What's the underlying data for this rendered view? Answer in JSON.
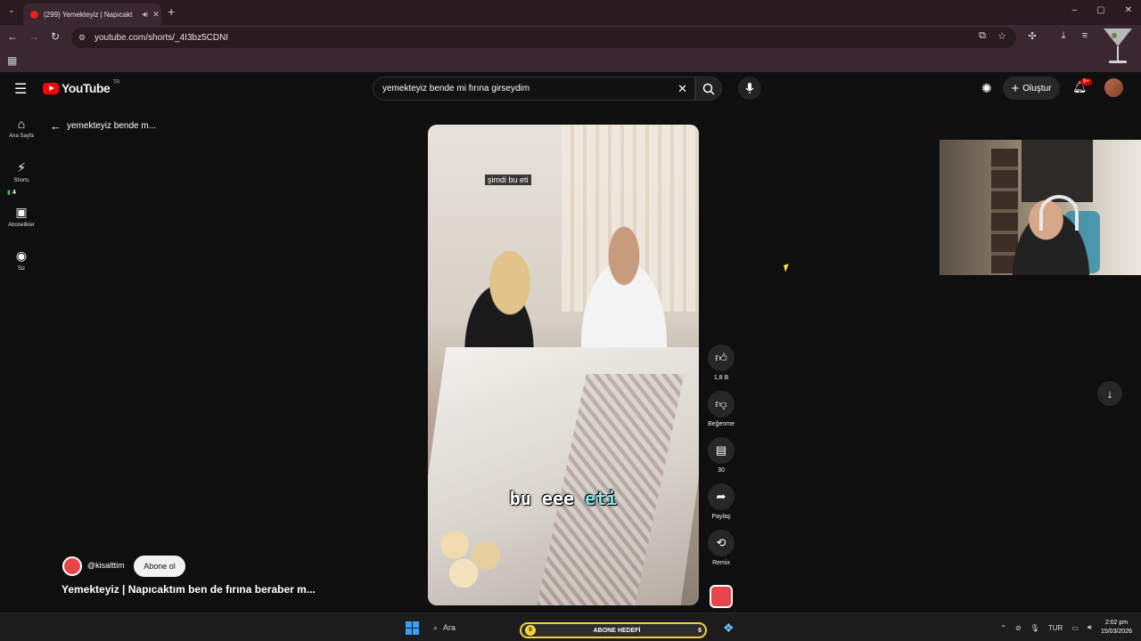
{
  "browser": {
    "tab_title": "(299) Yemekteyiz | Napıcakt",
    "url": "youtube.com/shorts/_4I3bz5CDNI",
    "window_controls": [
      "–",
      "▢",
      "✕"
    ]
  },
  "header": {
    "logo_text": "YouTube",
    "country_code": "TR",
    "search_value": "yemekteyiz bende mi fırına girseydim",
    "create_label": "Oluştur",
    "notification_badge": "9+"
  },
  "sidebar": {
    "items": [
      {
        "label": "Ana Sayfa",
        "icon": "home-icon"
      },
      {
        "label": "Shorts",
        "icon": "shorts-icon"
      },
      {
        "label": "Abonelikler",
        "icon": "subscriptions-icon"
      },
      {
        "label": "Siz",
        "icon": "user-icon"
      }
    ],
    "shorts_count": "4"
  },
  "back_label": "yemekteyiz bende m...",
  "video": {
    "subtitle_top": "şimdi bu eti",
    "caption_part1": "bu eee ",
    "caption_highlight": "eti"
  },
  "actions": {
    "like_count": "1,8 B",
    "dislike_label": "Beğenme",
    "comment_count": "30",
    "share_label": "Paylaş",
    "remix_label": "Remix"
  },
  "channel": {
    "handle": "@kisalttim",
    "subscribe_label": "Abone ol",
    "video_title": "Yemekteyiz | Napıcaktım ben de fırına beraber m..."
  },
  "taskbar": {
    "search_label": "Ara",
    "goal_label": "ABONE HEDEFİ",
    "goal_current": "0",
    "goal_target": "6",
    "language": "TUR",
    "time": "2:02 pm",
    "date": "15/03/2026"
  },
  "colors": {
    "youtube_red": "#ff0000",
    "goal_border": "#f5d23a",
    "caption_highlight": "#7fe3ef"
  }
}
